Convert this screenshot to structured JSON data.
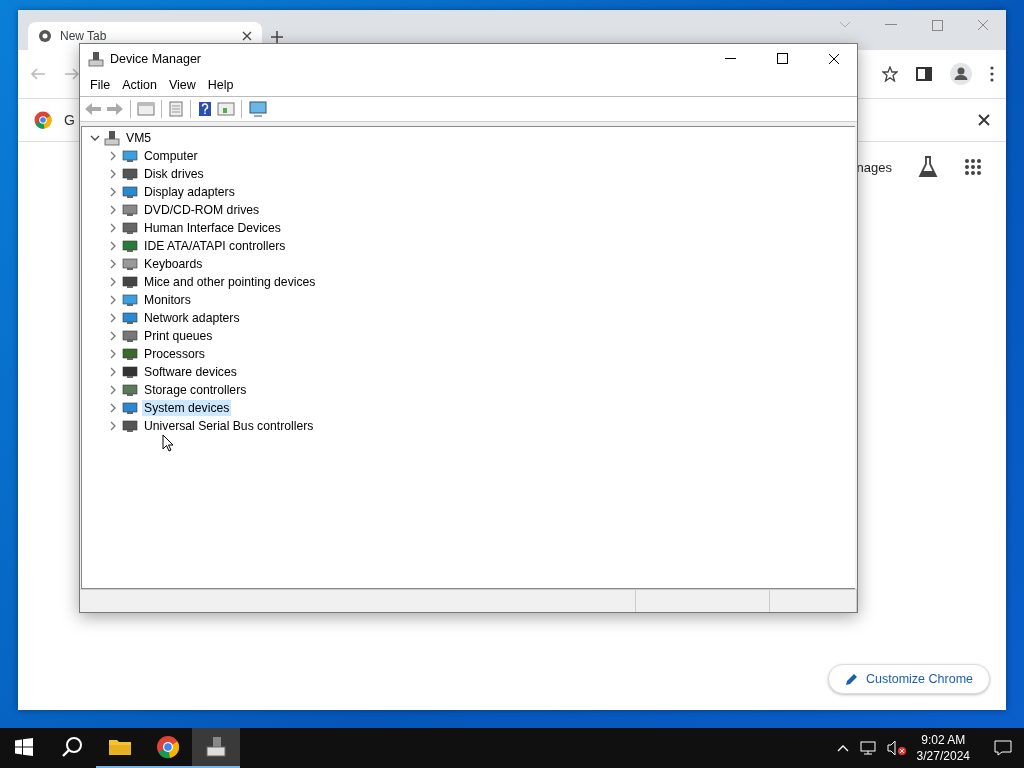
{
  "browser": {
    "tabs": [
      {
        "label": "New Tab",
        "selected": true
      }
    ],
    "bookmark_text": "G",
    "header_link": "nages",
    "customize_button": "Customize Chrome"
  },
  "device_manager": {
    "title": "Device Manager",
    "menu": [
      "File",
      "Action",
      "View",
      "Help"
    ],
    "tree": [
      {
        "label": "VM5",
        "expanded": true,
        "selected": false,
        "children": [
          {
            "label": "Computer",
            "expanded": false,
            "selected": false
          },
          {
            "label": "Disk drives",
            "expanded": false,
            "selected": false
          },
          {
            "label": "Display adapters",
            "expanded": false,
            "selected": false
          },
          {
            "label": "DVD/CD-ROM drives",
            "expanded": false,
            "selected": false
          },
          {
            "label": "Human Interface Devices",
            "expanded": false,
            "selected": false
          },
          {
            "label": "IDE ATA/ATAPI controllers",
            "expanded": false,
            "selected": false
          },
          {
            "label": "Keyboards",
            "expanded": false,
            "selected": false
          },
          {
            "label": "Mice and other pointing devices",
            "expanded": false,
            "selected": false
          },
          {
            "label": "Monitors",
            "expanded": false,
            "selected": false
          },
          {
            "label": "Network adapters",
            "expanded": false,
            "selected": false
          },
          {
            "label": "Print queues",
            "expanded": false,
            "selected": false
          },
          {
            "label": "Processors",
            "expanded": false,
            "selected": false
          },
          {
            "label": "Software devices",
            "expanded": false,
            "selected": false
          },
          {
            "label": "Storage controllers",
            "expanded": false,
            "selected": false
          },
          {
            "label": "System devices",
            "expanded": false,
            "selected": true
          },
          {
            "label": "Universal Serial Bus controllers",
            "expanded": false,
            "selected": false
          }
        ]
      }
    ]
  },
  "taskbar": {
    "apps": [
      {
        "kind": "folder",
        "selected": false
      },
      {
        "kind": "browser",
        "selected": false
      },
      {
        "kind": "devices",
        "selected": true
      }
    ],
    "clock": {
      "time": "9:02 AM",
      "date": "3/27/2024"
    }
  }
}
